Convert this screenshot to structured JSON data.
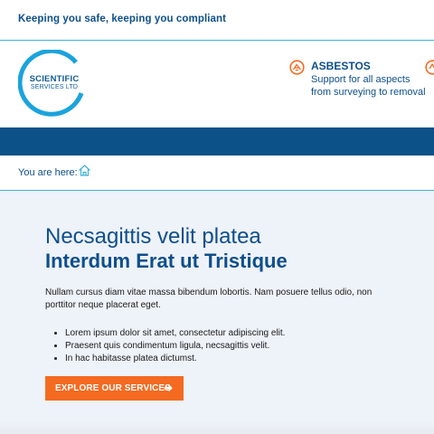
{
  "topbar": {
    "tagline": "Keeping you safe, keeping you compliant"
  },
  "logo": {
    "line1": "SCIENTIFIC",
    "line2": "SERVICES LTD",
    "ring_color": "#1ba3dd"
  },
  "service": {
    "title": "ASBESTOS",
    "description": "Support for all aspects from surveying to removal",
    "icon": "asbestos-icon",
    "accent": "#f46a21"
  },
  "breadcrumb": {
    "label": "You are here:",
    "icon": "home-icon"
  },
  "hero": {
    "subtitle": "Necsagittis velit platea",
    "title": "Interdum Erat ut Tristique",
    "body": "Nullam cursus diam vitae massa bibendum lobortis. Nam posuere tellus odio, non porttitor neque placerat eget.",
    "bullets": [
      "Lorem ipsum dolor sit amet, consectetur adipiscing elit.",
      "Praesent quis condimentum ligula, necsagittis velit.",
      "In hac habitasse platea dictumst."
    ],
    "cta_label": "EXPLORE OUR SERVICES",
    "cta_icon": "arrow-right-icon"
  },
  "colors": {
    "brand_blue": "#0d4f8b",
    "nav_blue": "#0d5189",
    "accent_orange": "#f46a21",
    "rule_cyan": "#3bb3d6"
  }
}
